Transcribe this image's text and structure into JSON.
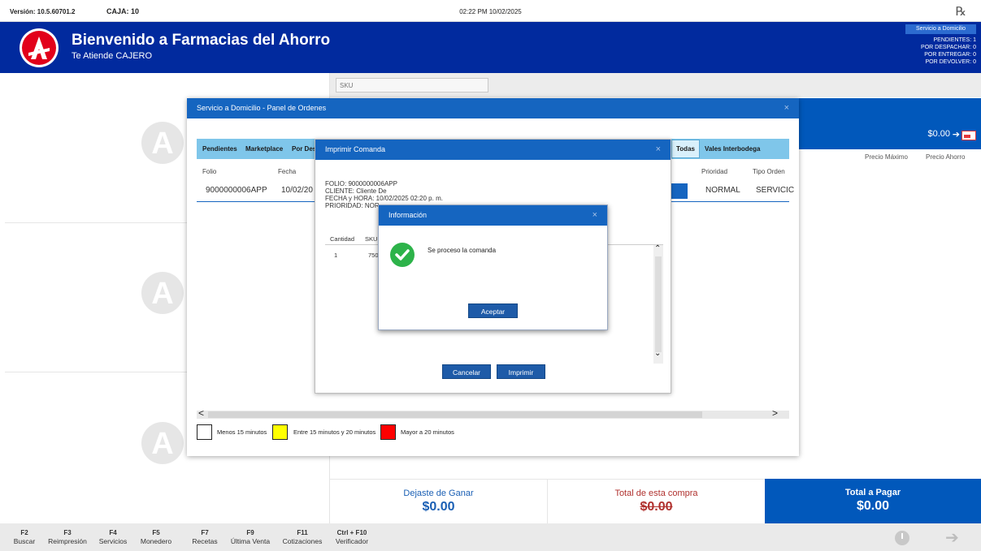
{
  "topbar": {
    "version": "Versión: 10.5.60701.2",
    "caja": "CAJA: 10",
    "datetime": "02:22 PM 10/02/2025",
    "rx_glyph": "℞"
  },
  "header": {
    "title": "Bienvenido a Farmacias del Ahorro",
    "subtitle": "Te Atiende CAJERO",
    "servicio_btn": "Servicio a Domicilio",
    "stats": [
      "PENDIENTES: 1",
      "POR DESPACHAR: 0",
      "POR ENTREGAR: 0",
      "POR DEVOLVER: 0"
    ]
  },
  "sku_placeholder": "SKU",
  "right": {
    "amount": "$0.00",
    "arrow": "➔",
    "precio_max": "Precio Máximo",
    "precio_ahorro": "Precio Ahorro"
  },
  "totals": {
    "dejaste_label": "Dejaste de Ganar",
    "dejaste_value": "$0.00",
    "compra_label": "Total de esta compra",
    "compra_value": "$0.00",
    "pagar_label": "Total a Pagar",
    "pagar_value": "$0.00"
  },
  "footer": [
    {
      "key": "F2",
      "label": "Buscar"
    },
    {
      "key": "F3",
      "label": "Reimpresión"
    },
    {
      "key": "F4",
      "label": "Servicios"
    },
    {
      "key": "F5",
      "label": "Monedero"
    },
    {
      "key": "F7",
      "label": "Recetas"
    },
    {
      "key": "F9",
      "label": "Última Venta"
    },
    {
      "key": "F11",
      "label": "Cotizaciones"
    },
    {
      "key": "Ctrl + F10",
      "label": "Verificador"
    }
  ],
  "panel": {
    "title": "Servicio a Domicilio - Panel de Ordenes",
    "close": "×",
    "tabs": [
      "Pendientes",
      "Marketplace",
      "Por Des",
      "Todas",
      "Vales Interbodega"
    ],
    "headers": {
      "folio": "Folio",
      "fecha": "Fecha",
      "prioridad": "Prioridad",
      "tipo": "Tipo Orden"
    },
    "row": {
      "folio": "9000000006APP",
      "fecha": "10/02/20",
      "prioridad": "NORMAL",
      "tipo": "SERVICIC"
    },
    "scroll_left": "<",
    "scroll_right": ">",
    "legend": [
      {
        "label": "Menos 15 minutos",
        "color": "#ffffff"
      },
      {
        "label": "Entre 15 minutos y 20 minutos",
        "color": "#ffff00"
      },
      {
        "label": "Mayor a 20 minutos",
        "color": "#ff0000"
      }
    ]
  },
  "comanda": {
    "title": "Imprimir Comanda",
    "close": "×",
    "info": [
      "FOLIO: 9000000006APP",
      "CLIENTE: Cliente De",
      "FECHA y HORA: 10/02/2025 02:20 p. m.",
      "PRIORIDAD: NOR"
    ],
    "col_cantidad": "Cantidad",
    "col_sku": "SKU",
    "row_cantidad": "1",
    "row_sku": "750",
    "up_arrow": "⌃",
    "down_arrow": "⌄",
    "cancel": "Cancelar",
    "print": "Imprimir"
  },
  "info_dialog": {
    "title": "Información",
    "close": "×",
    "message": "Se proceso la comanda",
    "ok": "Aceptar"
  }
}
